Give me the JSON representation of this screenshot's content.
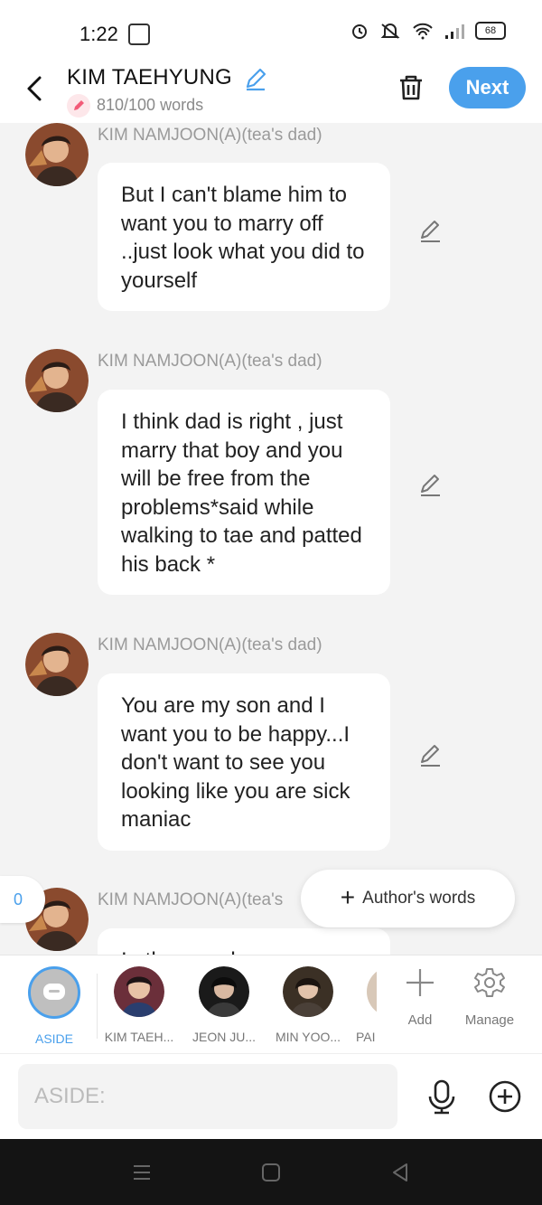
{
  "status_bar": {
    "time": "1:22",
    "battery": "68"
  },
  "header": {
    "title": "KIM TAEHYUNG",
    "word_count": "810/100 words",
    "next_label": "Next"
  },
  "messages": [
    {
      "sender": "KIM NAMJOON(A)(tea's dad)",
      "text": "But I can't blame him to want you to marry off ..just look what you did to yourself"
    },
    {
      "sender": "KIM NAMJOON(A)(tea's dad)",
      "text": "I think dad is right , just marry that boy and you will be free from the problems*said while walking to tae and patted his back *"
    },
    {
      "sender": "KIM NAMJOON(A)(tea's dad)",
      "text": "You are my son and I want you to be happy...I don't want to see you looking like you are sick maniac"
    },
    {
      "sender": "KIM NAMJOON(A)(tea's",
      "text": "I...the...mod..."
    }
  ],
  "overlay": {
    "count_toggle": "0",
    "author_words": "Author's words"
  },
  "character_bar": {
    "aside_label": "ASIDE",
    "characters": [
      "KIM TAEH...",
      "JEON JU...",
      "MIN YOO...",
      "PAI"
    ],
    "add_label": "Add",
    "manage_label": "Manage"
  },
  "input": {
    "placeholder": "ASIDE:"
  },
  "colors": {
    "accent": "#4aa0ec",
    "background": "#f3f3f3"
  }
}
